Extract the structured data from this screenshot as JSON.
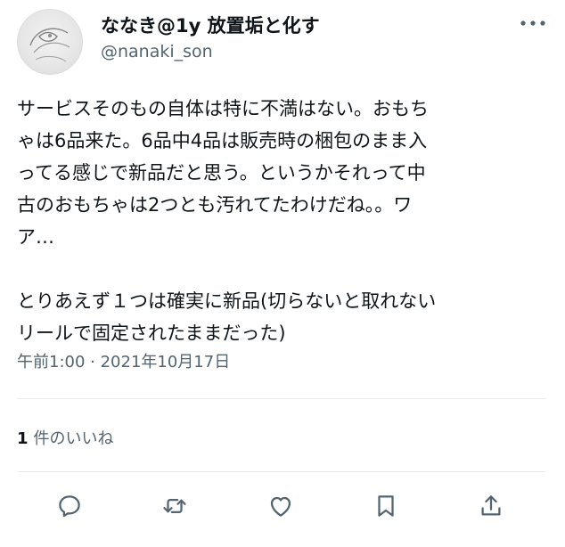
{
  "author": {
    "display_name": "ななき@1y 放置垢と化す",
    "handle": "@nanaki_son",
    "avatar_icon": "sketch-avatar-icon"
  },
  "tweet": {
    "text": "サービスそのもの自体は特に不満はない。おもち\nゃは6品来た。6品中4品は販売時の梱包のまま入\nってる感じで新品だと思う。というかそれって中\n古のおもちゃは2つとも汚れてたわけだね。。ワ\nア…\n\nとりあえず１つは確実に新品(切らないと取れない\nリールで固定されたままだった)",
    "timestamp": "午前1:00 · 2021年10月17日"
  },
  "stats": {
    "like_count": "1",
    "like_label": "件のいいね"
  },
  "actions": [
    {
      "name": "reply",
      "icon": "reply-icon"
    },
    {
      "name": "retweet",
      "icon": "retweet-icon"
    },
    {
      "name": "like",
      "icon": "heart-icon"
    },
    {
      "name": "bookmark",
      "icon": "bookmark-icon"
    },
    {
      "name": "share",
      "icon": "share-icon"
    }
  ],
  "colors": {
    "text": "#0f1419",
    "secondary": "#536471",
    "divider": "#e6ecf0",
    "icon": "#536471"
  }
}
